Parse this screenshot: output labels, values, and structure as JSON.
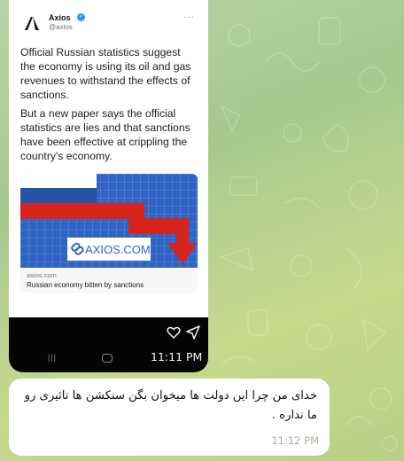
{
  "tweet": {
    "account_name": "Axios",
    "account_handle": "@axios",
    "paragraph_1": "Official Russian statistics suggest the economy is using its oil and gas revenues to withstand the effects of sanctions.",
    "paragraph_2": "But a new paper says the official statistics are lies and that sanctions have been effective at crippling the country's economy.",
    "link_image_text": "AXIOS.COM",
    "link_domain": "axios.com",
    "link_title": "Russian economy bitten by sanctions"
  },
  "image_message": {
    "time": "11:11 PM"
  },
  "text_message": {
    "text": "خدای من چرا این دولت ها میخوان بگن سنکشن ها تاثیری رو ما نداره .",
    "time": "11:12 PM"
  },
  "colors": {
    "chat_background": "#b9d3a4",
    "bubble": "#ffffff",
    "verified_badge": "#1d9bf0",
    "flag_red": "#d7241c",
    "flag_blue": "#2553a5",
    "chart_blue": "#2f63c5"
  },
  "icons": [
    "verified-icon",
    "more-icon",
    "link-icon",
    "heart-icon",
    "send-icon",
    "recents-nav-icon",
    "home-nav-icon"
  ]
}
